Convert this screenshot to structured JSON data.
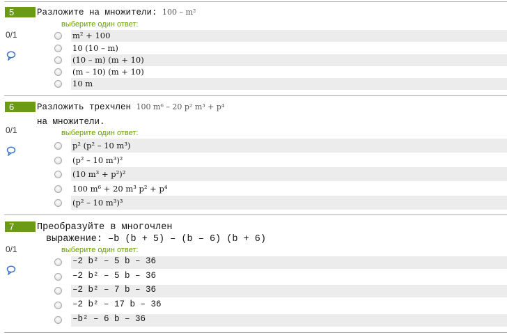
{
  "questions": [
    {
      "number": "5",
      "text": "Разложите на множители:",
      "math": "100 – m²",
      "text2": "",
      "score": "0/1",
      "prompt": "выберите один ответ:",
      "options": [
        "m² + 100",
        "10 (10 – m)",
        "(10 – m) (m + 10)",
        "(m – 10) (m + 10)",
        "10 m"
      ]
    },
    {
      "number": "6",
      "text": "Разложить трехчлен",
      "math": "100 m⁶ – 20 p² m³ + p⁴",
      "text2": "на множители.",
      "score": "0/1",
      "prompt": "выберите один ответ:",
      "options": [
        "p² (p² – 10 m³)",
        "(p² – 10 m³)²",
        "(10 m³ + p²)²",
        "100 m⁶ + 20 m³ p² + p⁴",
        "(p² – 10 m³)³"
      ]
    },
    {
      "number": "7",
      "text": "Преобразуйте в многочлен",
      "math": "",
      "text2": "выражение: –b (b + 5) – (b – 6) (b + 6)",
      "score": "0/1",
      "prompt": "выберите один ответ:",
      "options": [
        "–2 b² – 5 b – 36",
        "–2 b² – 5 b – 36",
        "–2 b² – 7 b – 36",
        "–2 b² – 17 b – 36",
        "–b² – 6 b – 36"
      ]
    }
  ],
  "colors": {
    "badge": "#6b9a17",
    "prompt": "#6aa000",
    "band": "#ececec",
    "link": "#3b73c4"
  },
  "icons": {
    "comment": "speech-bubble-icon",
    "radio": "radio-button"
  }
}
